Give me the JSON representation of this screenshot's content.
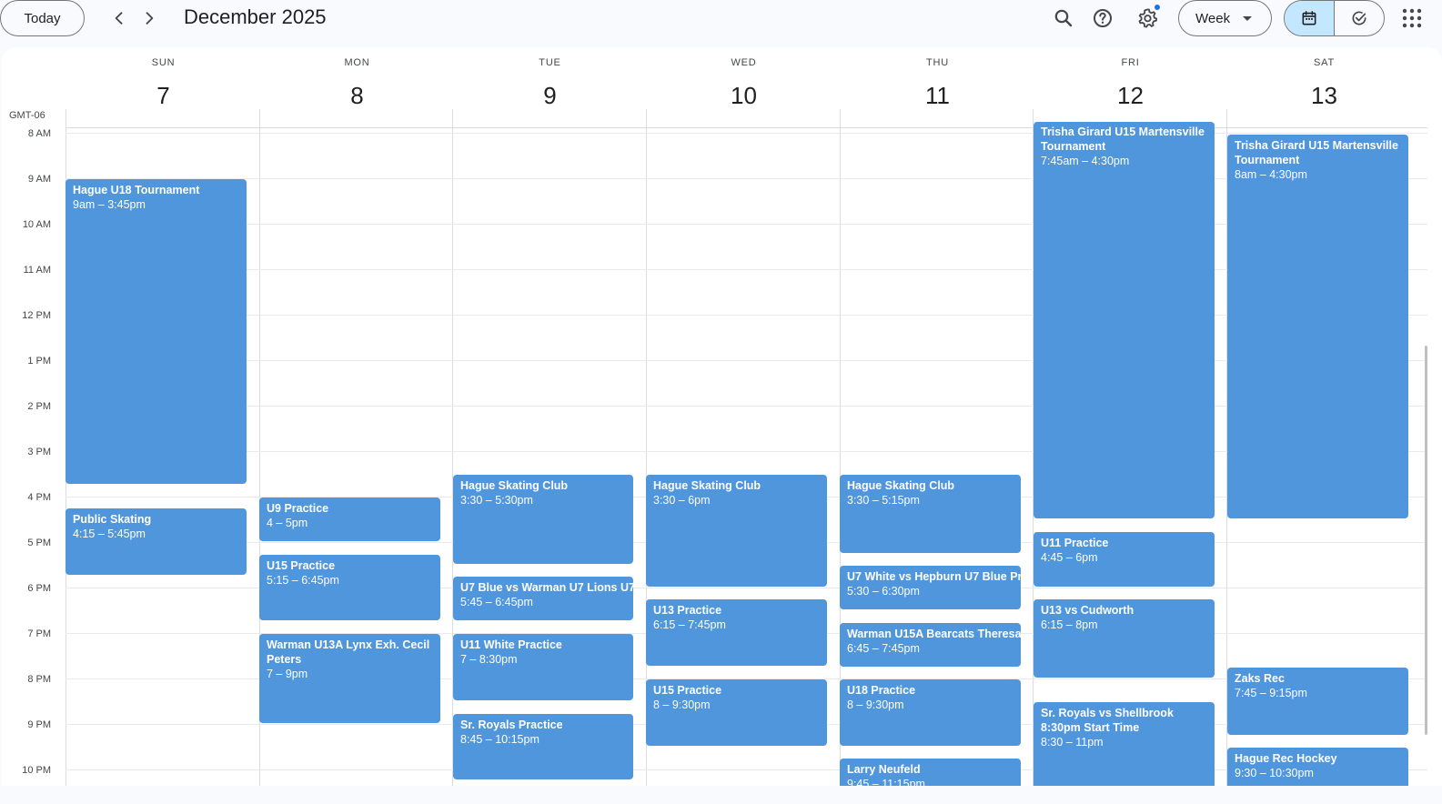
{
  "topbar": {
    "today_label": "Today",
    "prev_icon": "chevron-left-icon",
    "next_icon": "chevron-right-icon",
    "month_title": "December 2025",
    "search_icon": "search-icon",
    "help_icon": "help-icon",
    "settings_icon": "gear-icon",
    "view_select_label": "Week",
    "calendar_view_icon": "calendar-icon",
    "tasks_view_icon": "task-check-icon",
    "apps_icon": "apps-grid-icon"
  },
  "calendar": {
    "timezone": "GMT-06",
    "days": [
      {
        "name": "SUN",
        "num": "7"
      },
      {
        "name": "MON",
        "num": "8"
      },
      {
        "name": "TUE",
        "num": "9"
      },
      {
        "name": "WED",
        "num": "10"
      },
      {
        "name": "THU",
        "num": "11"
      },
      {
        "name": "FRI",
        "num": "12"
      },
      {
        "name": "SAT",
        "num": "13"
      }
    ],
    "hours": [
      "8 AM",
      "9 AM",
      "10 AM",
      "11 AM",
      "12 PM",
      "1 PM",
      "2 PM",
      "3 PM",
      "4 PM",
      "5 PM",
      "6 PM",
      "7 PM",
      "8 PM",
      "9 PM",
      "10 PM"
    ],
    "events": [
      {
        "day": 0,
        "title": "Hague U18 Tournament",
        "time": "9am – 3:45pm"
      },
      {
        "day": 0,
        "title": "Public Skating",
        "time": "4:15 – 5:45pm"
      },
      {
        "day": 1,
        "title": "U9 Practice",
        "time": "4 – 5pm"
      },
      {
        "day": 1,
        "title": "U15 Practice",
        "time": "5:15 – 6:45pm"
      },
      {
        "day": 1,
        "title": "Warman U13A Lynx Exh. Cecil Peters",
        "time": "7 – 9pm"
      },
      {
        "day": 2,
        "title": "Hague Skating Club",
        "time": "3:30 – 5:30pm"
      },
      {
        "day": 2,
        "title": "U7 Blue vs Warman U7 Lions U7",
        "time": "5:45 – 6:45pm"
      },
      {
        "day": 2,
        "title": "U11 White Practice",
        "time": "7 – 8:30pm"
      },
      {
        "day": 2,
        "title": "Sr. Royals Practice",
        "time": "8:45 – 10:15pm"
      },
      {
        "day": 3,
        "title": "Hague Skating Club",
        "time": "3:30 – 6pm"
      },
      {
        "day": 3,
        "title": "U13 Practice",
        "time": "6:15 – 7:45pm"
      },
      {
        "day": 3,
        "title": "U15 Practice",
        "time": "8 – 9:30pm"
      },
      {
        "day": 4,
        "title": "Hague Skating Club",
        "time": "3:30 – 5:15pm"
      },
      {
        "day": 4,
        "title": "U7 White vs Hepburn U7 Blue Pr",
        "time": "5:30 – 6:30pm"
      },
      {
        "day": 4,
        "title": "Warman U15A Bearcats Theresa",
        "time": "6:45 – 7:45pm"
      },
      {
        "day": 4,
        "title": "U18 Practice",
        "time": "8 – 9:30pm"
      },
      {
        "day": 4,
        "title": "Larry Neufeld",
        "time": "9:45 – 11:15pm"
      },
      {
        "day": 5,
        "title": "Trisha Girard U15 Martensville Tournament",
        "time": "7:45am – 4:30pm"
      },
      {
        "day": 5,
        "title": "U11 Practice",
        "time": "4:45 – 6pm"
      },
      {
        "day": 5,
        "title": "U13 vs Cudworth",
        "time": "6:15 – 8pm"
      },
      {
        "day": 5,
        "title": "Sr. Royals vs Shellbrook 8:30pm Start Time",
        "time": "8:30 – 11pm"
      },
      {
        "day": 6,
        "title": "Trisha Girard U15 Martensville Tournament",
        "time": "8am – 4:30pm"
      },
      {
        "day": 6,
        "title": "Zaks Rec",
        "time": "7:45 – 9:15pm"
      },
      {
        "day": 6,
        "title": "Hague Rec Hockey",
        "time": "9:30 – 10:30pm"
      }
    ]
  }
}
